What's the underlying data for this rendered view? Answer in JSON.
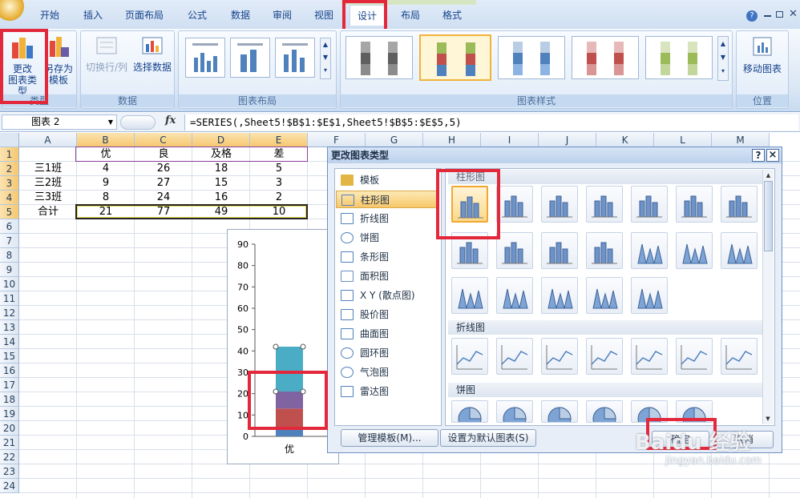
{
  "ribbon": {
    "tabs": [
      "开始",
      "插入",
      "页面布局",
      "公式",
      "数据",
      "审阅",
      "视图",
      "设计",
      "布局",
      "格式"
    ],
    "active_tab": "设计",
    "type_group": {
      "label": "类型",
      "change_type": "更改\n图表类型",
      "save_template": "另存为\n模板"
    },
    "data_group": {
      "label": "数据",
      "switch_row_col": "切换行/列",
      "select_data": "选择数据"
    },
    "layout_group": {
      "label": "图表布局"
    },
    "style_group": {
      "label": "图表样式"
    },
    "location_group": {
      "label": "位置",
      "move_chart": "移动图表"
    }
  },
  "formula_bar": {
    "name_box": "图表 2",
    "fx": "fx",
    "formula": "=SERIES(,Sheet5!$B$1:$E$1,Sheet5!$B$5:$E$5,5)"
  },
  "sheet": {
    "columns": [
      "A",
      "B",
      "C",
      "D",
      "E",
      "F",
      "G",
      "H",
      "I",
      "J",
      "K",
      "L",
      "M"
    ],
    "rows": [
      "1",
      "2",
      "3",
      "4",
      "5",
      "6",
      "7",
      "8",
      "9",
      "10",
      "11",
      "12",
      "13",
      "14",
      "15",
      "16",
      "17",
      "18",
      "19",
      "20",
      "21",
      "22",
      "23",
      "24"
    ],
    "data": [
      [
        "",
        "优",
        "良",
        "及格",
        "差"
      ],
      [
        "三1班",
        "4",
        "26",
        "18",
        "5"
      ],
      [
        "三2班",
        "9",
        "27",
        "15",
        "3"
      ],
      [
        "三3班",
        "8",
        "24",
        "16",
        "2"
      ],
      [
        "合计",
        "21",
        "77",
        "49",
        "10"
      ]
    ]
  },
  "chart_data": {
    "type": "bar",
    "stacked": true,
    "categories": [
      "优"
    ],
    "series": [
      {
        "values": [
          4
        ],
        "color": "#4f81bd"
      },
      {
        "values": [
          9
        ],
        "color": "#c0504d"
      },
      {
        "values": [
          8
        ],
        "color": "#8064a2"
      },
      {
        "values": [
          21
        ],
        "color": "#4bacc6"
      }
    ],
    "yticks": [
      "0",
      "10",
      "20",
      "30",
      "40",
      "50",
      "60",
      "70",
      "80",
      "90"
    ],
    "ylim": [
      0,
      90
    ]
  },
  "dialog": {
    "title": "更改图表类型",
    "help": "?",
    "close": "×",
    "categories": [
      {
        "label": "模板",
        "icon": "folder-icon"
      },
      {
        "label": "柱形图",
        "icon": "column-chart-icon"
      },
      {
        "label": "折线图",
        "icon": "line-chart-icon"
      },
      {
        "label": "饼图",
        "icon": "pie-chart-icon"
      },
      {
        "label": "条形图",
        "icon": "bar-chart-icon"
      },
      {
        "label": "面积图",
        "icon": "area-chart-icon"
      },
      {
        "label": "X Y (散点图)",
        "icon": "scatter-chart-icon"
      },
      {
        "label": "股价图",
        "icon": "stock-chart-icon"
      },
      {
        "label": "曲面图",
        "icon": "surface-chart-icon"
      },
      {
        "label": "圆环图",
        "icon": "doughnut-chart-icon"
      },
      {
        "label": "气泡图",
        "icon": "bubble-chart-icon"
      },
      {
        "label": "雷达图",
        "icon": "radar-chart-icon"
      }
    ],
    "selected_category": "柱形图",
    "section_column": "柱形图",
    "section_line": "折线图",
    "section_pie": "饼图",
    "manage_templates": "管理模板(M)...",
    "set_default": "设置为默认图表(S)",
    "ok": "确定",
    "cancel": "取消"
  },
  "watermark": {
    "text": "Baidu 经验",
    "url": "jingyan.baidu.com"
  }
}
